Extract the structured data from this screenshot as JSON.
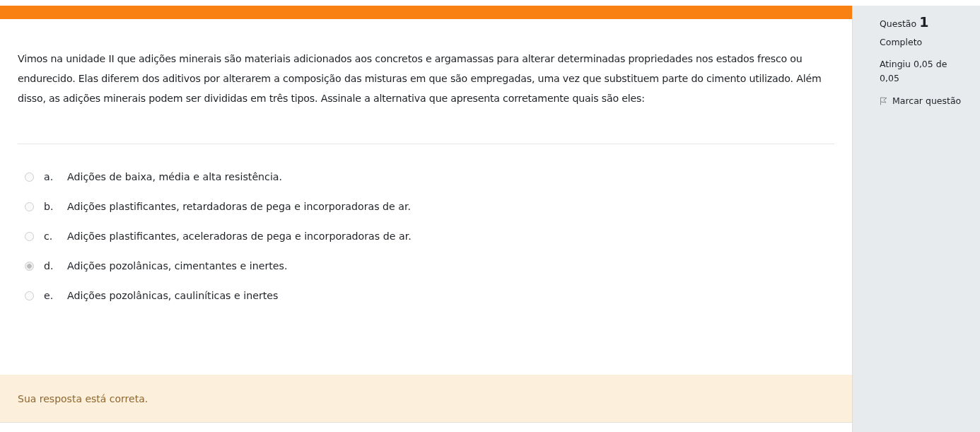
{
  "question": {
    "text": "Vimos na unidade II que adições minerais são materiais adicionados aos concretos e argamassas para alterar determinadas propriedades nos estados fresco ou endurecido. Elas diferem dos aditivos por alterarem a composição das misturas em que são empregadas, uma vez que substituem parte do cimento utilizado. Além disso, as adições minerais podem ser divididas em três tipos. Assinale a alternativa que apresenta corretamente quais são eles:",
    "options": [
      {
        "letter": "a.",
        "text": "Adições de baixa, média e alta resistência.",
        "selected": false
      },
      {
        "letter": "b.",
        "text": "Adições plastificantes, retardadoras de pega e incorporadoras de ar.",
        "selected": false
      },
      {
        "letter": "c.",
        "text": "Adições plastificantes, aceleradoras de pega e incorporadoras de ar.",
        "selected": false
      },
      {
        "letter": "d.",
        "text": "Adições pozolânicas, cimentantes e inertes.",
        "selected": true
      },
      {
        "letter": "e.",
        "text": "Adições pozolânicas, cauliníticas e inertes",
        "selected": false
      }
    ],
    "feedback": "Sua resposta está correta."
  },
  "info": {
    "label": "Questão",
    "number": "1",
    "state": "Completo",
    "grade": "Atingiu 0,05 de 0,05",
    "flag": "Marcar questão"
  }
}
